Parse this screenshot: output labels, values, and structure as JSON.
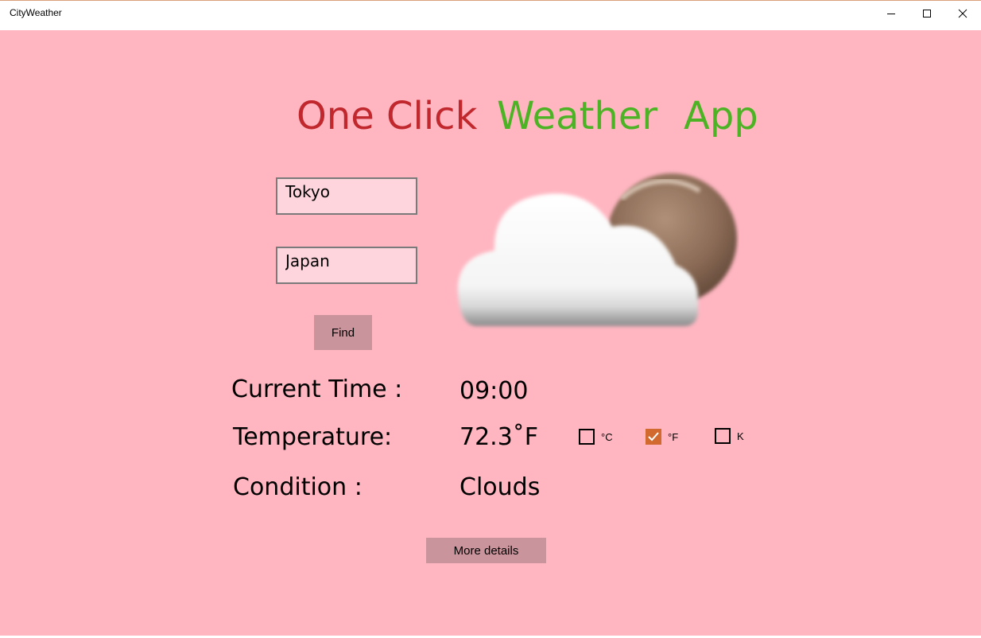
{
  "window": {
    "title": "CityWeather"
  },
  "heading": {
    "part1": "One Click",
    "part2": "Weather",
    "part3": "App",
    "color_part1": "#c0282d",
    "color_part2": "#4cb424"
  },
  "form": {
    "city_value": "Tokyo",
    "country_value": "Japan",
    "find_label": "Find"
  },
  "weather": {
    "icon": "cloud-with-moon-icon",
    "time_label": "Current  Time :",
    "time_value": "09:00",
    "temperature_label": "Temperature:",
    "temperature_value": "72.3˚F",
    "condition_label": "Condition  :",
    "condition_value": "Clouds"
  },
  "units": [
    {
      "label": "°C",
      "checked": false
    },
    {
      "label": "°F",
      "checked": true
    },
    {
      "label": "K",
      "checked": false
    }
  ],
  "more_details_label": "More details",
  "colors": {
    "background": "#ffb6c1",
    "button": "#c9949b",
    "checkbox_accent": "#d2692f"
  }
}
